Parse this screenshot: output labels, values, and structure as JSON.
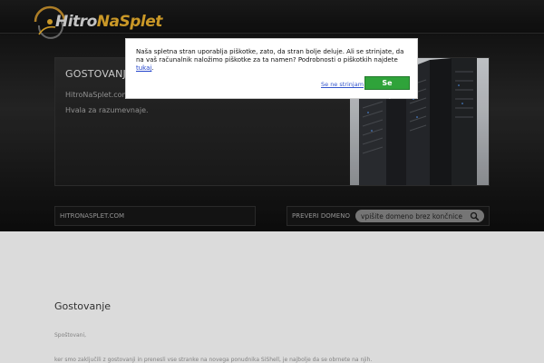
{
  "logo": {
    "part1": "Hitro",
    "part2": "NaSplet"
  },
  "banner": {
    "title": "GOSTOVANJE",
    "line1": "HitroNaSplet.com",
    "line2": "Hvala za razumevnaje."
  },
  "bar": {
    "domain_label": "HITRONASPLET.COM",
    "check_label": "PREVERI DOMENO",
    "search_placeholder": "vpišite domeno brez končnice"
  },
  "content": {
    "title": "Gostovanje",
    "line1": "Spoštovani,",
    "line2": "ker smo zaključili z gostovanji in prenesli vse stranke na novega ponudnika SiShell, je najbolje da se obrnete na njih."
  },
  "cookie": {
    "text": "Naša spletna stran uporablja piškotke, zato, da stran bolje deluje. Ali se strinjate, da na vaš računalnik naložimo piškotke za ta namen? Podrobnosti o piškotkih najdete",
    "link": "tukaj",
    "reject": "Se ne strinjam",
    "accept": "Se strinjam"
  },
  "colors": {
    "accent": "#d7a22a",
    "accept_green": "#2fa33a"
  },
  "icons": [
    "logo-swirl-icon",
    "search-icon"
  ]
}
